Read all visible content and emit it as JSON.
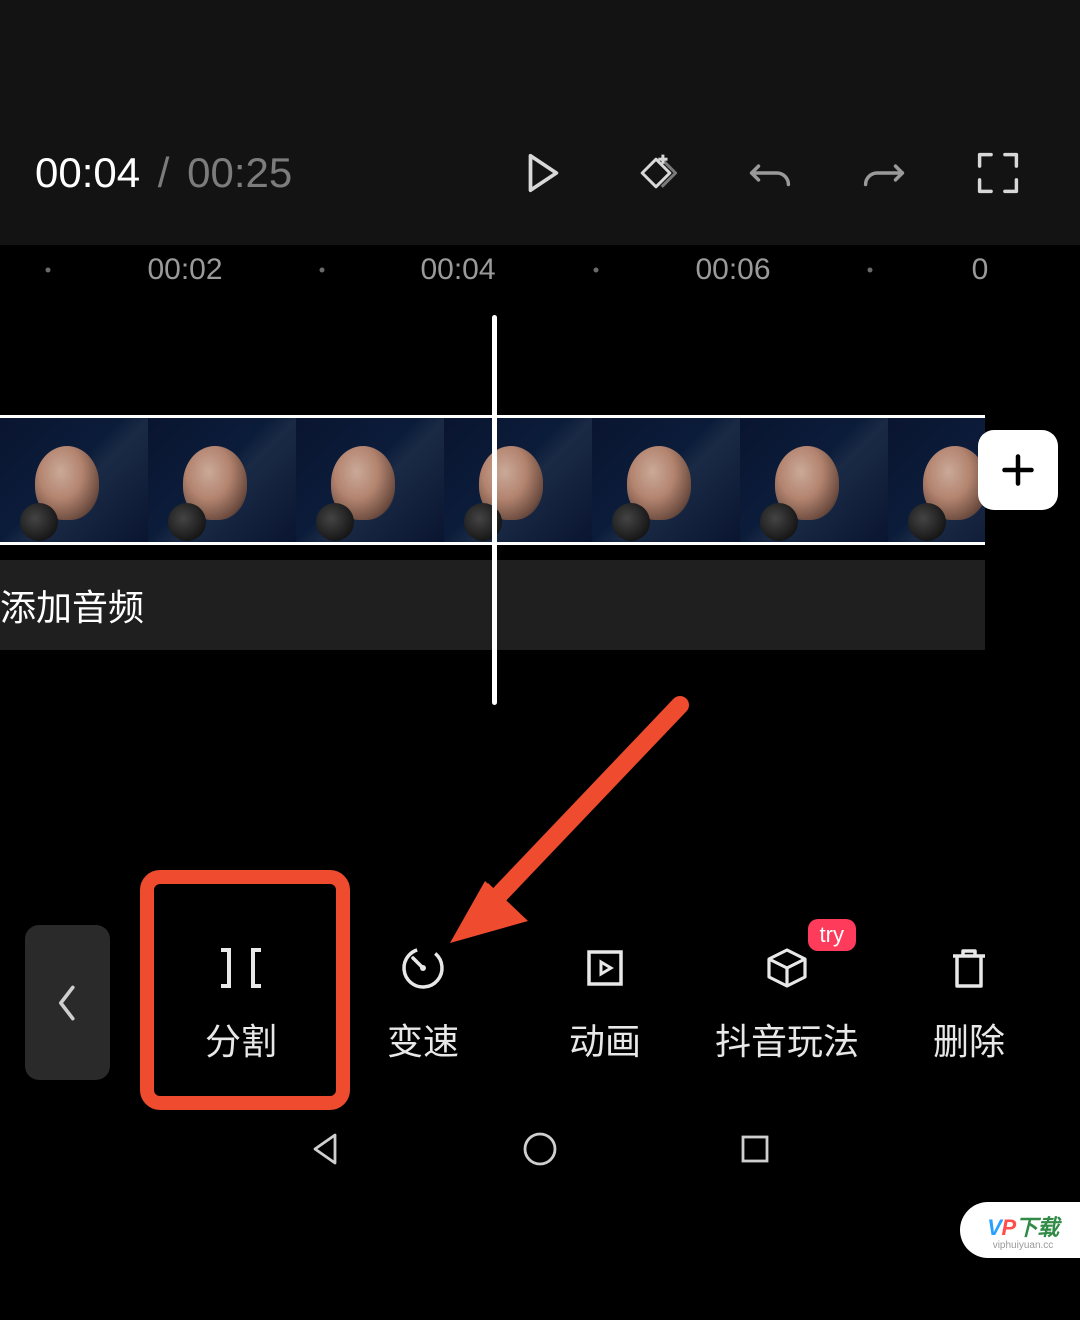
{
  "time": {
    "current": "00:04",
    "separator": "/",
    "total": "00:25"
  },
  "ruler": {
    "t1": "00:02",
    "t2": "00:04",
    "t3": "00:06",
    "t4": "0"
  },
  "audio": {
    "label": "添加音频"
  },
  "add_icon": "+",
  "toolbar": {
    "back": "‹",
    "items": [
      {
        "label": "分割",
        "badge": ""
      },
      {
        "label": "变速",
        "badge": ""
      },
      {
        "label": "动画",
        "badge": ""
      },
      {
        "label": "抖音玩法",
        "badge": "try"
      },
      {
        "label": "删除",
        "badge": ""
      }
    ]
  },
  "watermark": {
    "main_v": "V",
    "main_p": "P",
    "main_dl": "下载",
    "sub": "viphuiyuan.cc"
  }
}
